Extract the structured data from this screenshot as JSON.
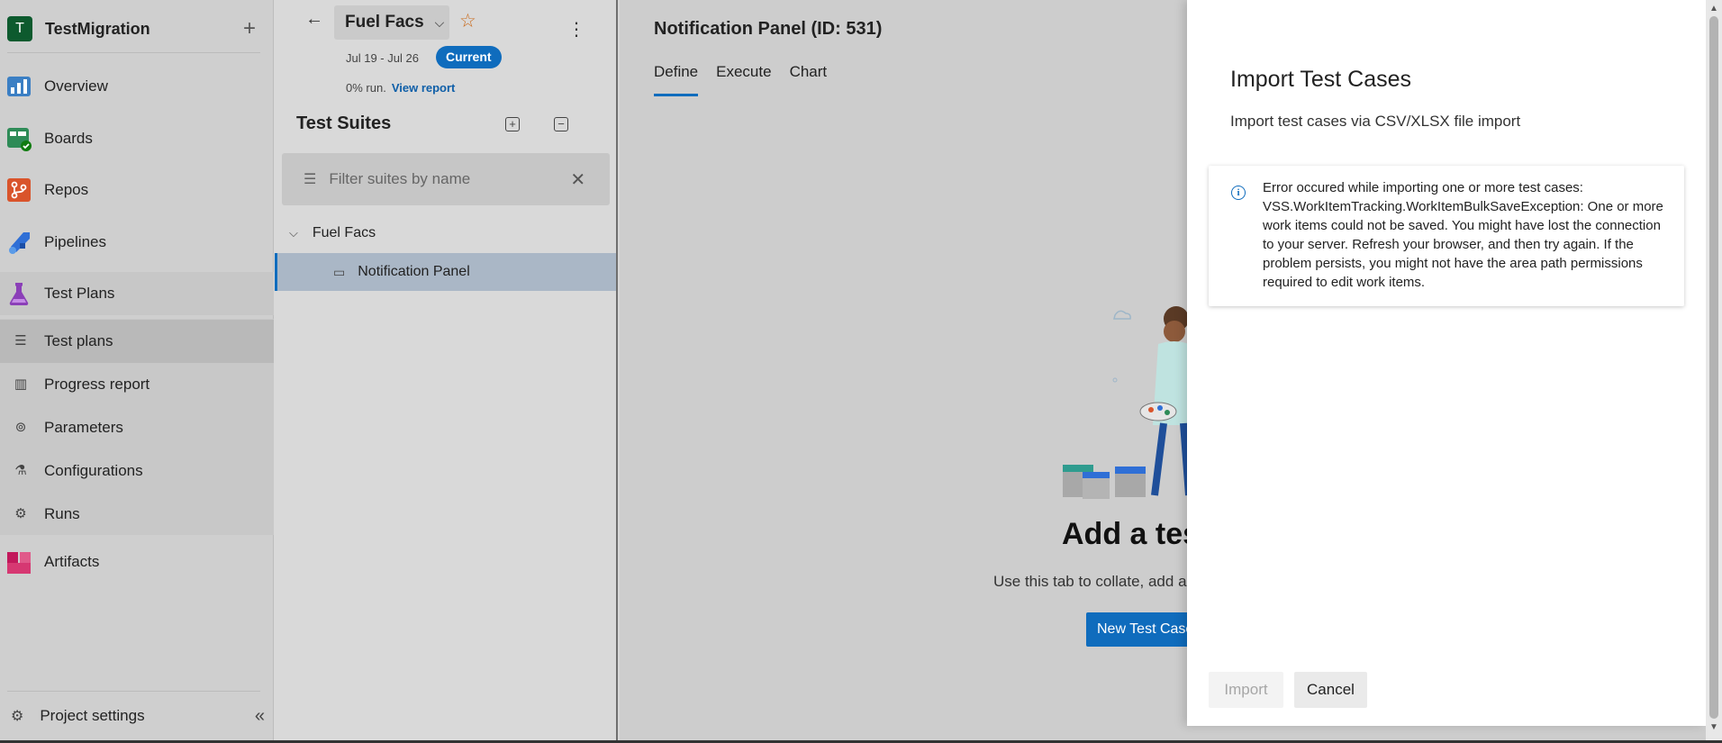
{
  "project": {
    "avatar_letter": "T",
    "name": "TestMigration",
    "add_symbol": "+"
  },
  "nav": {
    "items": [
      {
        "label": "Overview"
      },
      {
        "label": "Boards"
      },
      {
        "label": "Repos"
      },
      {
        "label": "Pipelines"
      },
      {
        "label": "Test Plans"
      },
      {
        "label": "Artifacts"
      }
    ],
    "sub_items": [
      {
        "label": "Test plans"
      },
      {
        "label": "Progress report"
      },
      {
        "label": "Parameters"
      },
      {
        "label": "Configurations"
      },
      {
        "label": "Runs"
      }
    ],
    "project_settings": "Project settings"
  },
  "plan": {
    "name": "Fuel Facs",
    "dates": "Jul 19 - Jul 26",
    "status": "Current",
    "run_text": "0% run.",
    "view_report": "View report"
  },
  "suites": {
    "title": "Test Suites",
    "filter_placeholder": "Filter suites by name",
    "root": "Fuel Facs",
    "child": "Notification Panel"
  },
  "main": {
    "title": "Notification Panel (ID: 531)",
    "tabs": [
      {
        "label": "Define"
      },
      {
        "label": "Execute"
      },
      {
        "label": "Chart"
      }
    ],
    "empty_title": "Add a test",
    "empty_sub": "Use this tab to collate, add ar",
    "new_test_case": "New Test Case"
  },
  "dialog": {
    "title": "Import Test Cases",
    "subtitle": "Import test cases via CSV/XLSX file import",
    "error": "Error occured while importing one or more test cases: VSS.WorkItemTracking.WorkItemBulkSaveException: One or more work items could not be saved. You might have lost the connection to your server. Refresh your browser, and then try again. If the problem persists, you might not have the area path permissions required to edit work items.",
    "import_label": "Import",
    "cancel_label": "Cancel"
  },
  "colors": {
    "accent": "#0f6cbd",
    "favorite_star": "#c96a1b"
  }
}
